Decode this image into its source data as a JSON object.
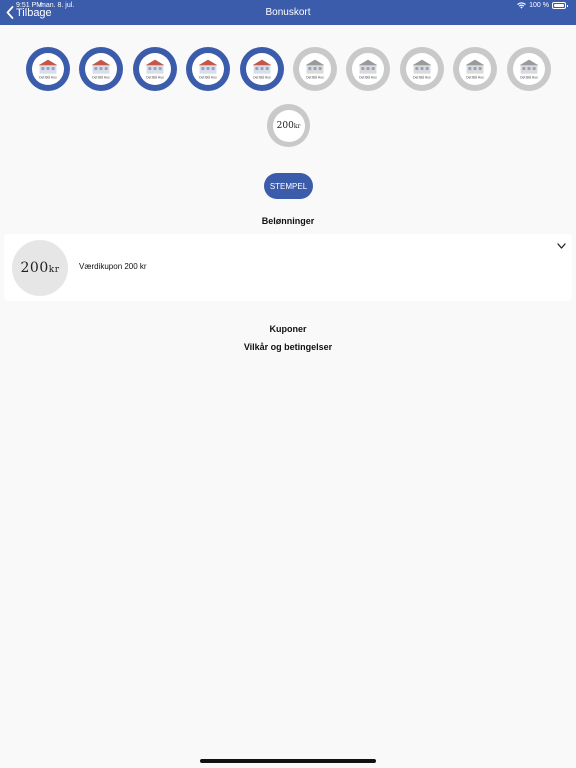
{
  "status_bar": {
    "time": "9:51 PM",
    "date": "man. 8. jul.",
    "battery": "100 %"
  },
  "nav": {
    "back_label": "Tilbage",
    "title": "Bonuskort"
  },
  "stamps": {
    "collected": 5,
    "total": 10,
    "logo_text": "Det Blå Hus"
  },
  "reward_stamp": {
    "value": "200",
    "unit": "kr"
  },
  "stempel_button": "STEMPEL",
  "rewards": {
    "title": "Belønninger",
    "items": [
      {
        "thumb_value": "200",
        "thumb_unit": "kr",
        "label": "Værdikupon 200 kr"
      }
    ]
  },
  "links": {
    "coupons": "Kuponer",
    "terms": "Vilkår og betingelser"
  },
  "colors": {
    "accent": "#3b5bab",
    "inactive": "#c9c9c9"
  }
}
